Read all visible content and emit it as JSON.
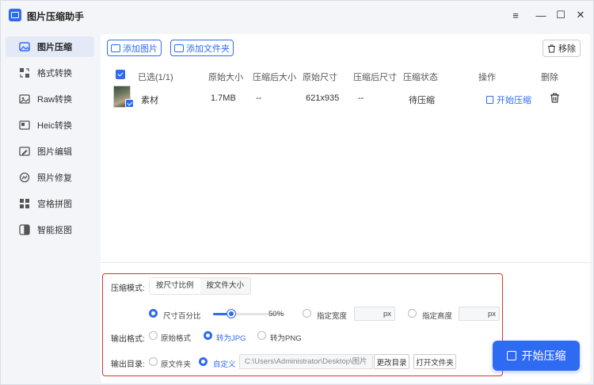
{
  "app": {
    "title": "图片压缩助手"
  },
  "window": {
    "minimize": "—",
    "maximize": "☐",
    "close": "✕",
    "menu": "≡"
  },
  "sidebar": {
    "items": [
      {
        "label": "图片压缩",
        "icon": "image-compress-icon",
        "active": true
      },
      {
        "label": "格式转换",
        "icon": "format-convert-icon"
      },
      {
        "label": "Raw转换",
        "icon": "raw-convert-icon"
      },
      {
        "label": "Heic转换",
        "icon": "heic-convert-icon"
      },
      {
        "label": "图片编辑",
        "icon": "image-edit-icon"
      },
      {
        "label": "照片修复",
        "icon": "photo-repair-icon"
      },
      {
        "label": "宫格拼图",
        "icon": "grid-collage-icon"
      },
      {
        "label": "智能抠图",
        "icon": "smart-cutout-icon"
      }
    ]
  },
  "toolbar": {
    "add_image": "添加图片",
    "add_folder": "添加文件夹",
    "remove": "移除"
  },
  "table": {
    "headers": {
      "selected": "已选(1/1)",
      "orig_size": "原始大小",
      "comp_size": "压缩后大小",
      "orig_dim": "原始尺寸",
      "comp_dim": "压缩后尺寸",
      "status": "压缩状态",
      "action": "操作",
      "delete": "删除"
    },
    "rows": [
      {
        "name": "素材",
        "orig_size": "1.7MB",
        "comp_size": "--",
        "orig_dim": "621x935",
        "comp_dim": "--",
        "status": "待压缩",
        "action": "开始压缩"
      }
    ]
  },
  "settings": {
    "mode_label": "压缩模式:",
    "tabs": [
      "按尺寸比例",
      "按文件大小"
    ],
    "size_percent_label": "尺寸百分比",
    "percent_value": "50%",
    "percent": 0.5,
    "width_label": "指定宽度",
    "height_label": "指定高度",
    "px_unit": "px",
    "format_label": "输出格式:",
    "formats": [
      "原始格式",
      "转为JPG",
      "转为PNG"
    ],
    "dir_label": "输出目录:",
    "dir_original": "原文件夹",
    "dir_custom": "自定义",
    "path": "C:\\Users\\Administrator\\Desktop\\图片",
    "change_dir": "更改目录",
    "open_folder": "打开文件夹"
  },
  "start_button": "开始压缩",
  "colors": {
    "accent": "#2f6bf2",
    "highlight": "#e0322b"
  }
}
